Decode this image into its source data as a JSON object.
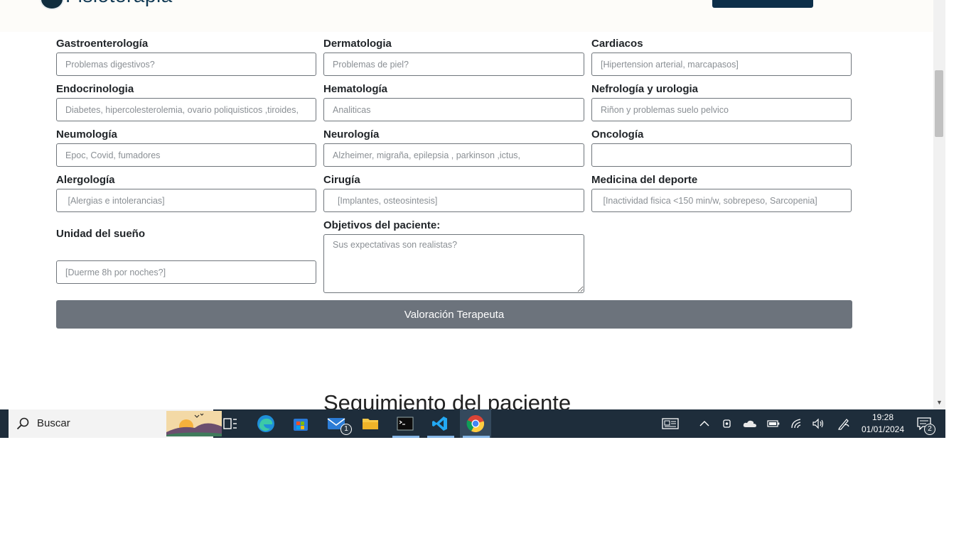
{
  "header": {
    "logo_text": "Fisioterapia"
  },
  "form": {
    "fields": [
      {
        "label": "Gastroenterología",
        "placeholder": "Problemas digestivos?"
      },
      {
        "label": "Dermatologia",
        "placeholder": "Problemas de piel?"
      },
      {
        "label": "Cardiacos",
        "placeholder": "[Hipertension arterial, marcapasos]"
      },
      {
        "label": "Endocrinologia",
        "placeholder": "Diabetes, hipercolesterolemia, ovario poliquisticos ,tiroides,"
      },
      {
        "label": "Hematología",
        "placeholder": "Analiticas"
      },
      {
        "label": "Nefrología y urologia",
        "placeholder": "Riñon y problemas suelo pelvico"
      },
      {
        "label": "Neumología",
        "placeholder": "Epoc, Covid, fumadores"
      },
      {
        "label": "Neurología",
        "placeholder": "Alzheimer, migraña, epilepsia , parkinson ,ictus,"
      },
      {
        "label": "Oncología",
        "placeholder": ""
      },
      {
        "label": "Alergología",
        "placeholder": " [Alergias e intolerancias]"
      },
      {
        "label": "Cirugía",
        "placeholder": "  [Implantes, osteosintesis]"
      },
      {
        "label": "Medicina del deporte",
        "placeholder": " [Inactividad fisica <150 min/w, sobrepeso, Sarcopenia]"
      },
      {
        "label": "Unidad del sueño",
        "placeholder": "[Duerme 8h por noches?]"
      },
      {
        "label": "Objetivos del paciente:",
        "placeholder": "Sus expectativas son realistas?"
      }
    ],
    "submit_label": "Valoración Terapeuta"
  },
  "section_heading": "Seguimiento del paciente",
  "taskbar": {
    "search_text": "Buscar",
    "mail_badge": "1",
    "apps": [
      "task-view-icon",
      "edge-icon",
      "store-icon",
      "mail-icon",
      "file-explorer-icon",
      "terminal-icon",
      "vscode-icon",
      "chrome-icon"
    ],
    "tray": [
      "news-icon",
      "chevron-up-icon",
      "meet-icon",
      "onedrive-icon",
      "battery-icon",
      "wifi-icon",
      "volume-icon",
      "pen-icon"
    ],
    "time": "19:28",
    "date": "01/01/2024",
    "notification_count": "2"
  },
  "colors": {
    "submit_bg": "#6c737c",
    "taskbar_bg": "#1e2d3b",
    "header_button": "#0d2f4a"
  }
}
